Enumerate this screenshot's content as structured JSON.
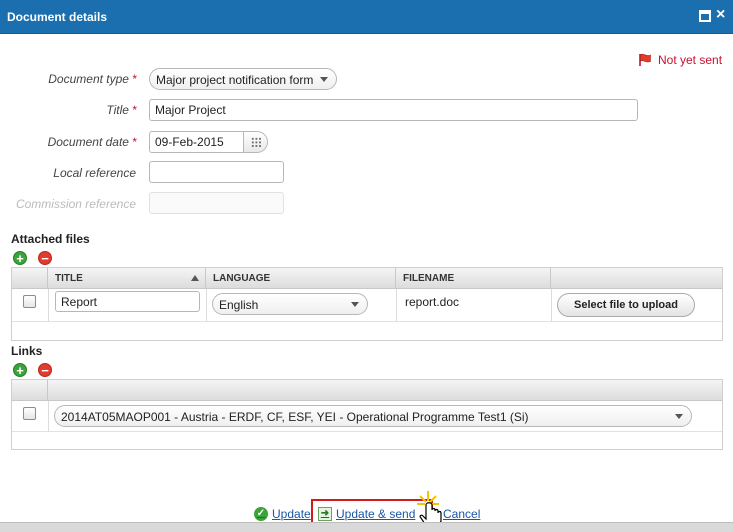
{
  "window": {
    "title": "Document details"
  },
  "status": {
    "text": "Not yet sent"
  },
  "form": {
    "document_type": {
      "label": "Document type",
      "value": "Major project notification form"
    },
    "title": {
      "label": "Title",
      "value": "Major Project"
    },
    "document_date": {
      "label": "Document date",
      "value": "09-Feb-2015"
    },
    "local_reference": {
      "label": "Local reference",
      "value": ""
    },
    "commission_reference": {
      "label": "Commission reference",
      "value": ""
    },
    "required_marker": "*"
  },
  "attached_files": {
    "section_title": "Attached files",
    "columns": {
      "title": "TITLE",
      "language": "LANGUAGE",
      "filename": "FILENAME"
    },
    "rows": [
      {
        "title": "Report",
        "language": "English",
        "filename": "report.doc",
        "upload_label": "Select file to upload"
      }
    ]
  },
  "links": {
    "section_title": "Links",
    "rows": [
      {
        "value": "2014AT05MAOP001 - Austria - ERDF, CF, ESF, YEI - Operational Programme Test1 (Si)"
      }
    ]
  },
  "actions": {
    "update": "Update",
    "update_send": "Update & send",
    "cancel": "Cancel"
  },
  "colors": {
    "header": "#1b6fae",
    "accent_red": "#c8102e",
    "link": "#1a56a8"
  }
}
